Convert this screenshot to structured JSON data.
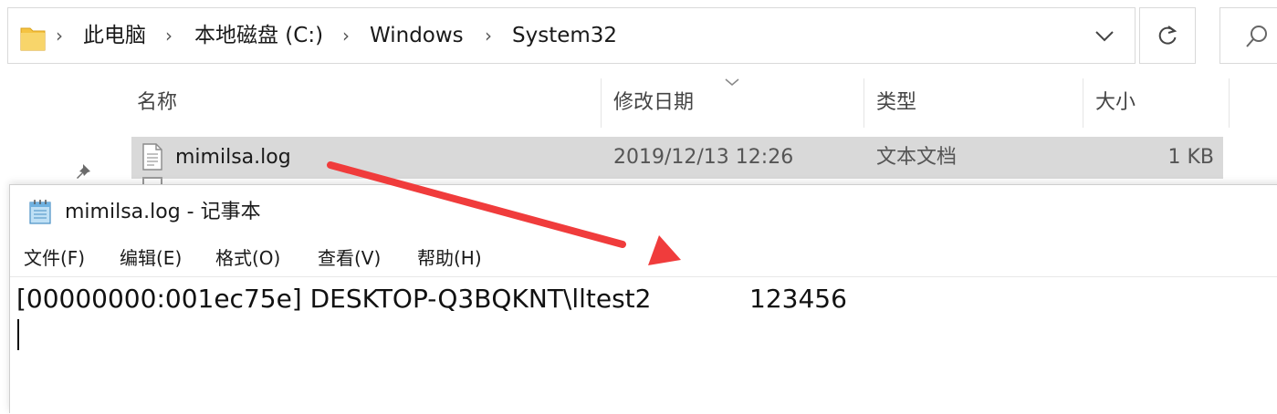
{
  "explorer": {
    "breadcrumbs": [
      "此电脑",
      "本地磁盘 (C:)",
      "Windows",
      "System32"
    ],
    "columns": [
      "名称",
      "修改日期",
      "类型",
      "大小"
    ],
    "file": {
      "name": "mimilsa.log",
      "modified": "2019/12/13 12:26",
      "type": "文本文档",
      "size": "1 KB"
    },
    "icons": {
      "folder": "folder-icon",
      "dropdown": "chevron-down-icon",
      "refresh": "refresh-icon",
      "search": "search-icon",
      "pin": "pin-icon",
      "file": "text-file-icon"
    }
  },
  "notepad": {
    "title": "mimilsa.log - 记事本",
    "menu": [
      "文件(F)",
      "编辑(E)",
      "格式(O)",
      "查看(V)",
      "帮助(H)"
    ],
    "content_line": "[00000000:001ec75e] DESKTOP-Q3BQKNT\\lltest2",
    "content_value": "123456"
  },
  "colors": {
    "selection": "#d9d9d9",
    "annotation_arrow": "#f03c3c",
    "folder": "#f5c342"
  }
}
